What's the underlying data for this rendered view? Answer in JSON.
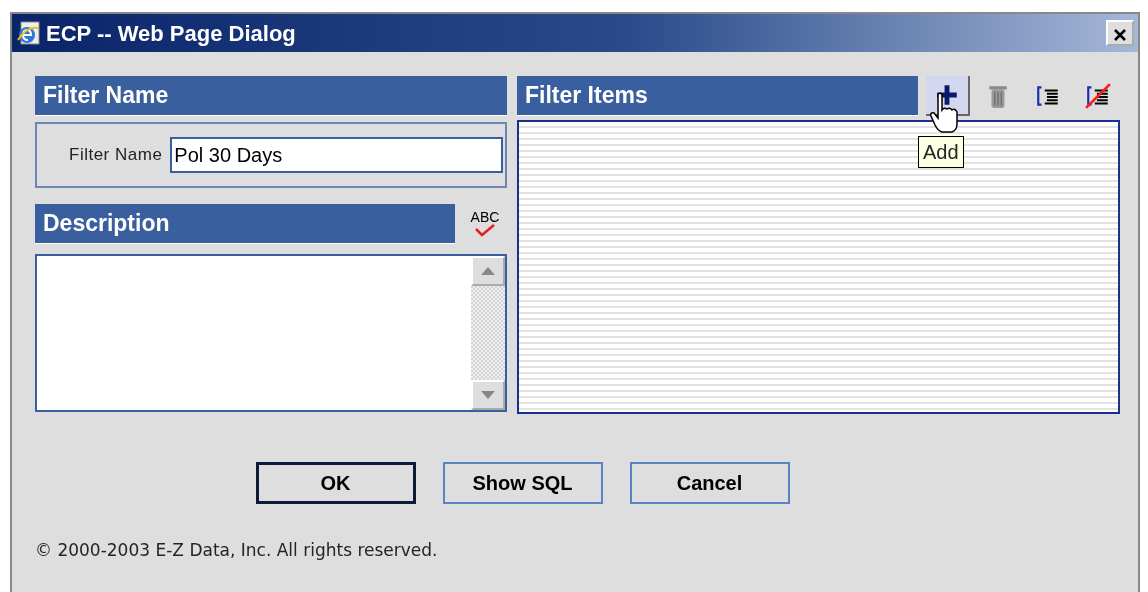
{
  "window": {
    "title": "ECP -- Web Page Dialog"
  },
  "filter_name_panel": {
    "header": "Filter Name",
    "label": "Filter Name",
    "value": "Pol 30 Days"
  },
  "description_panel": {
    "header": "Description",
    "spellcheck_label": "ABC"
  },
  "filter_items_panel": {
    "header": "Filter Items",
    "toolbar": [
      {
        "kind": "add",
        "hovered": true
      },
      {
        "kind": "delete",
        "hovered": false
      },
      {
        "kind": "indent",
        "hovered": false
      },
      {
        "kind": "clear",
        "hovered": false
      }
    ],
    "tooltip": "Add"
  },
  "buttons": [
    {
      "label": "OK",
      "default": true
    },
    {
      "label": "Show SQL",
      "default": false
    },
    {
      "label": "Cancel",
      "default": false
    }
  ],
  "copyright": "© 2000-2003 E-Z Data, Inc. All rights reserved."
}
